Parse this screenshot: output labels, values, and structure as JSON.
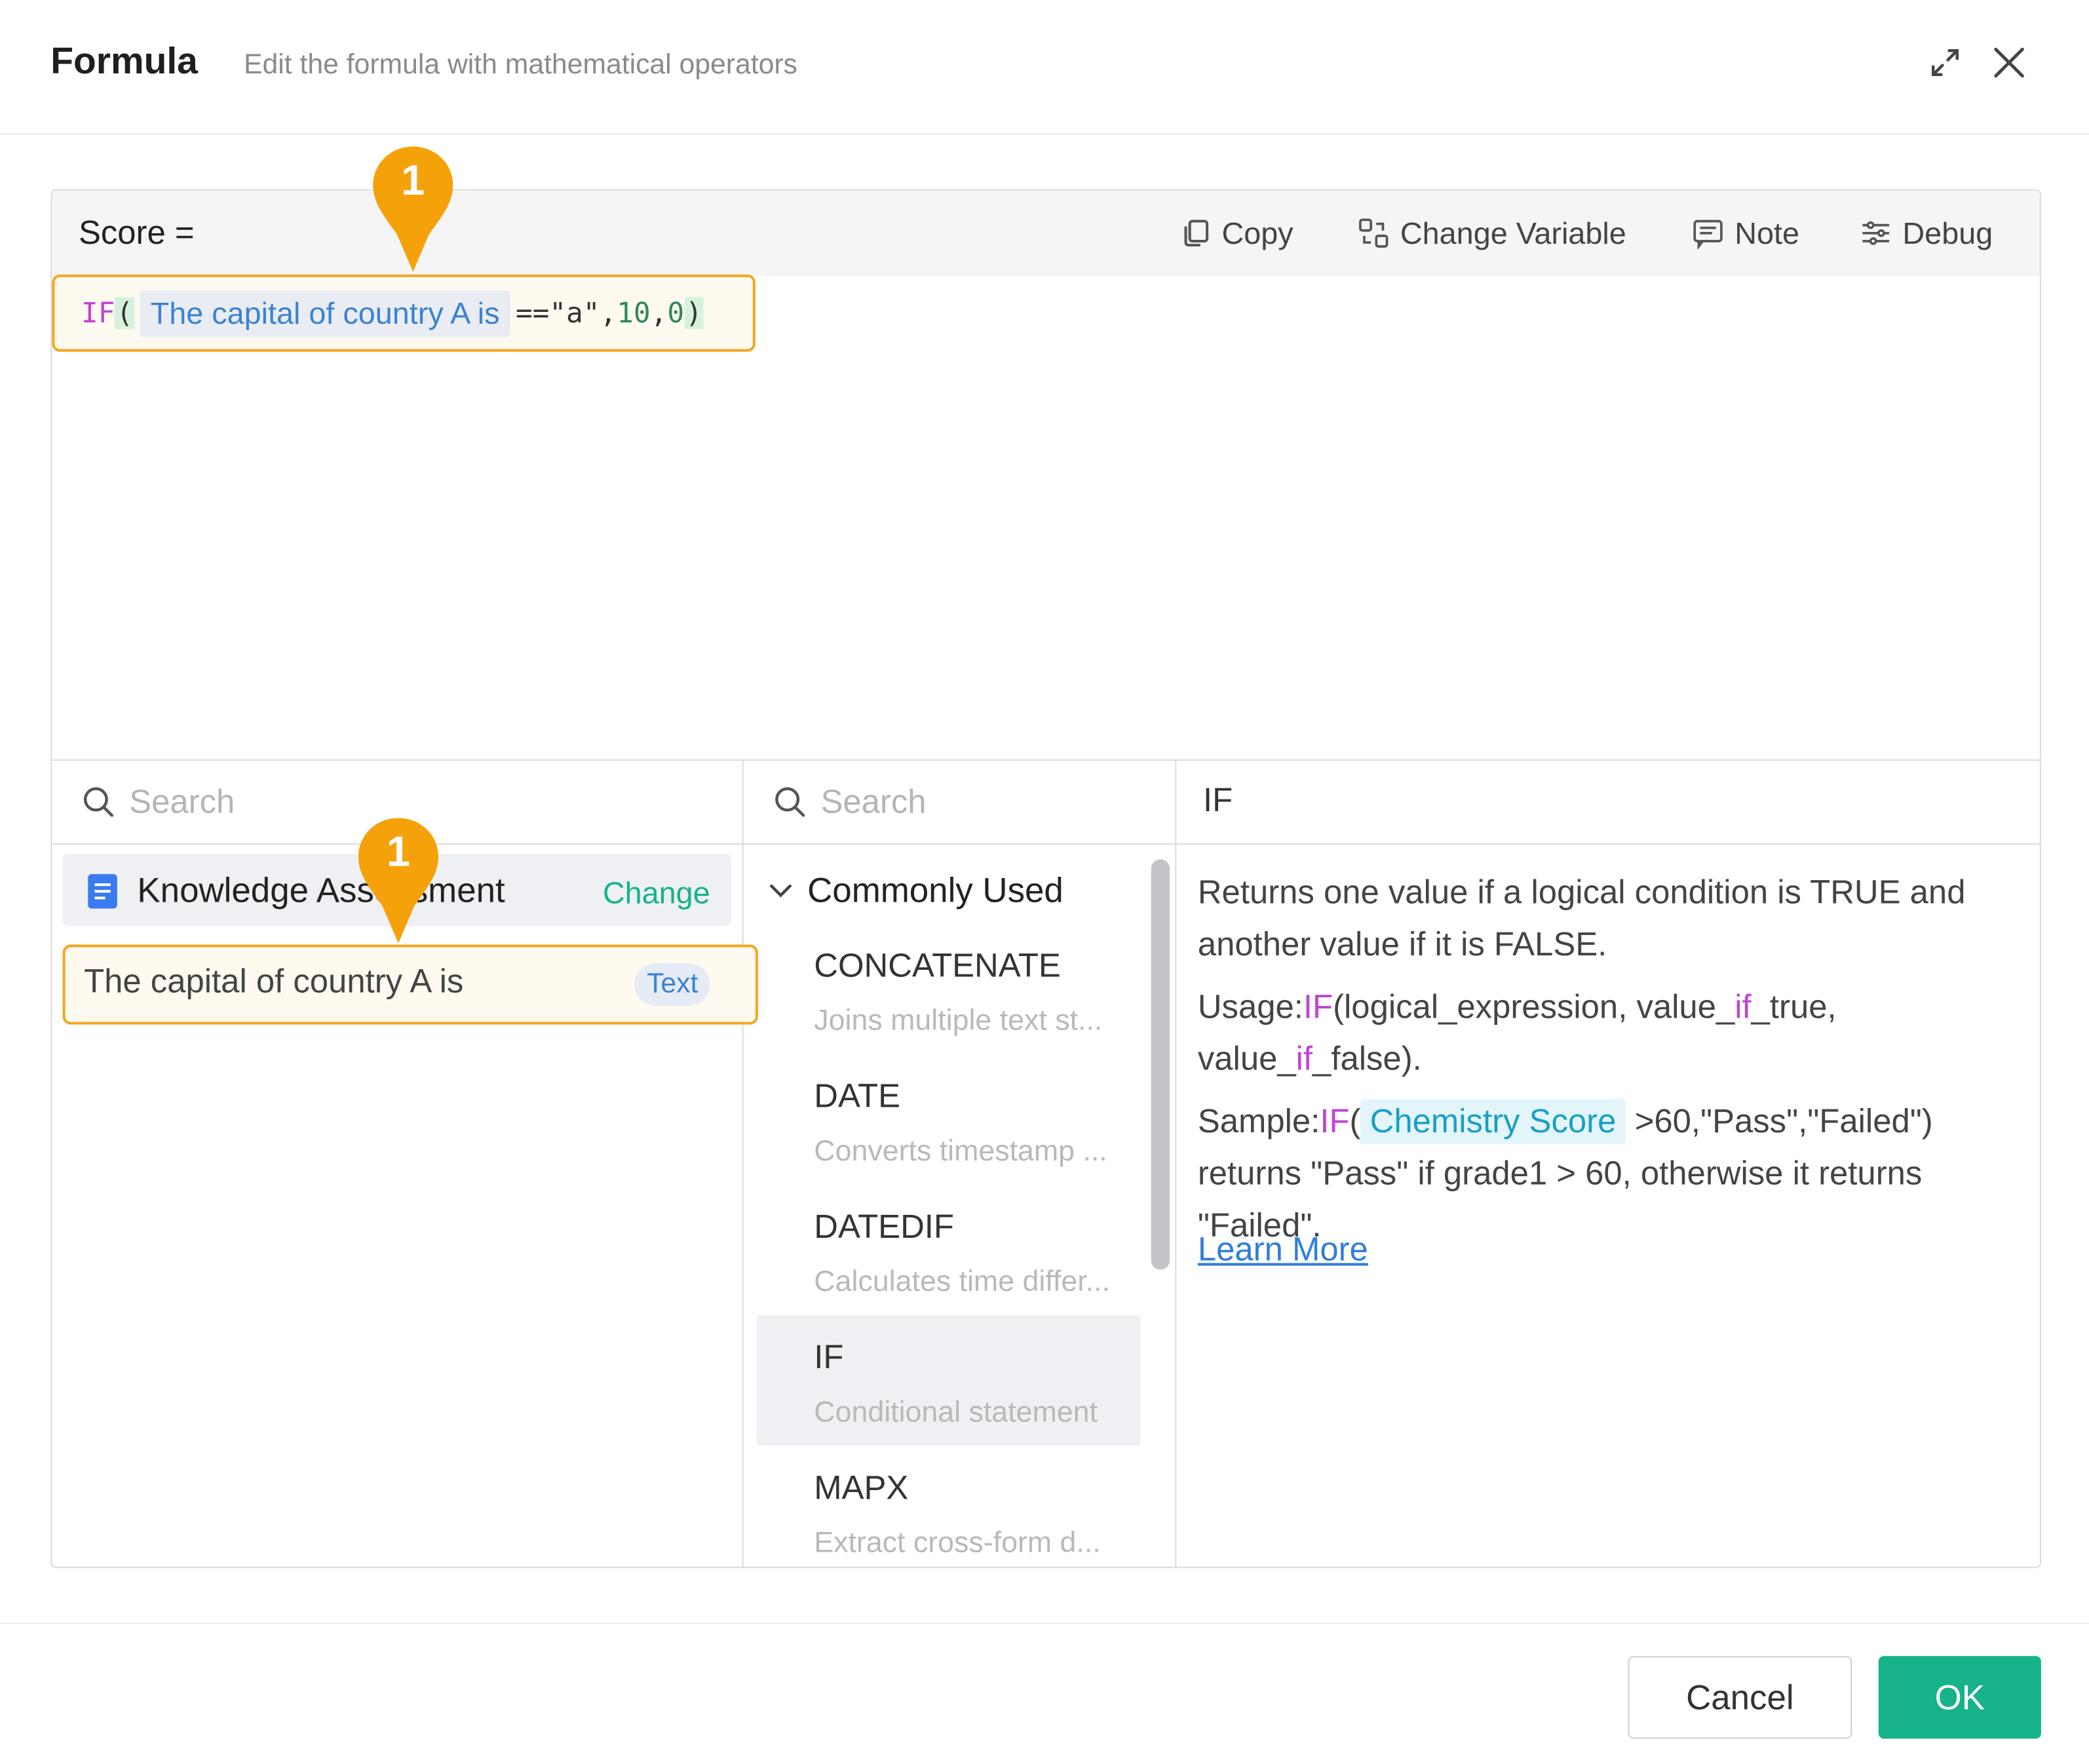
{
  "dialog": {
    "title": "Formula",
    "subtitle": "Edit the formula with mathematical operators",
    "icons": {
      "expand": "expand-icon",
      "close": "close-icon"
    }
  },
  "editor": {
    "result_label": "Score =",
    "toolbar": {
      "copy": "Copy",
      "change_variable": "Change Variable",
      "note": "Note",
      "debug": "Debug"
    },
    "formula": {
      "fn": "IF",
      "open": "(",
      "variable": "The capital of country A is",
      "op": "==\"a\",",
      "arg1": "10",
      "sep": ",",
      "arg2": "0",
      "close": ")"
    }
  },
  "fields_pane": {
    "search_placeholder": "Search",
    "form_name": "Knowledge Assessment",
    "change_label": "Change",
    "fields": [
      {
        "name": "The capital of country A is",
        "type": "Text"
      }
    ]
  },
  "functions_pane": {
    "search_placeholder": "Search",
    "category": "Commonly Used",
    "items": [
      {
        "name": "CONCATENATE",
        "desc": "Joins multiple text st..."
      },
      {
        "name": "DATE",
        "desc": "Converts timestamp ..."
      },
      {
        "name": "DATEDIF",
        "desc": "Calculates time differ..."
      },
      {
        "name": "IF",
        "desc": "Conditional statement"
      },
      {
        "name": "MAPX",
        "desc": "Extract cross-form d..."
      }
    ]
  },
  "detail_pane": {
    "title": "IF",
    "desc": "Returns one value if a logical condition is TRUE and another value if it is FALSE.",
    "usage_prefix": "Usage:",
    "usage_fn": "IF",
    "usage_a": "(logical_expression, value_",
    "usage_if1": "if",
    "usage_b": "_true, value_",
    "usage_if2": "if",
    "usage_c": "_false).",
    "sample_prefix": "Sample:",
    "sample_fn": "IF",
    "sample_paren": "(",
    "sample_var": "Chemistry Score",
    "sample_rest": " >60,\"Pass\",\"Failed\")",
    "sample_explain": "returns \"Pass\" if grade1 > 60, otherwise it returns \"Failed\".",
    "learn_more": "Learn More"
  },
  "footer": {
    "cancel": "Cancel",
    "ok": "OK"
  },
  "annotations": {
    "marker1": "1",
    "marker2": "1"
  },
  "colors": {
    "accent": "#16b38a",
    "highlight": "#f5a623",
    "keyword": "#c044d2",
    "variable": "#3c82d2"
  }
}
